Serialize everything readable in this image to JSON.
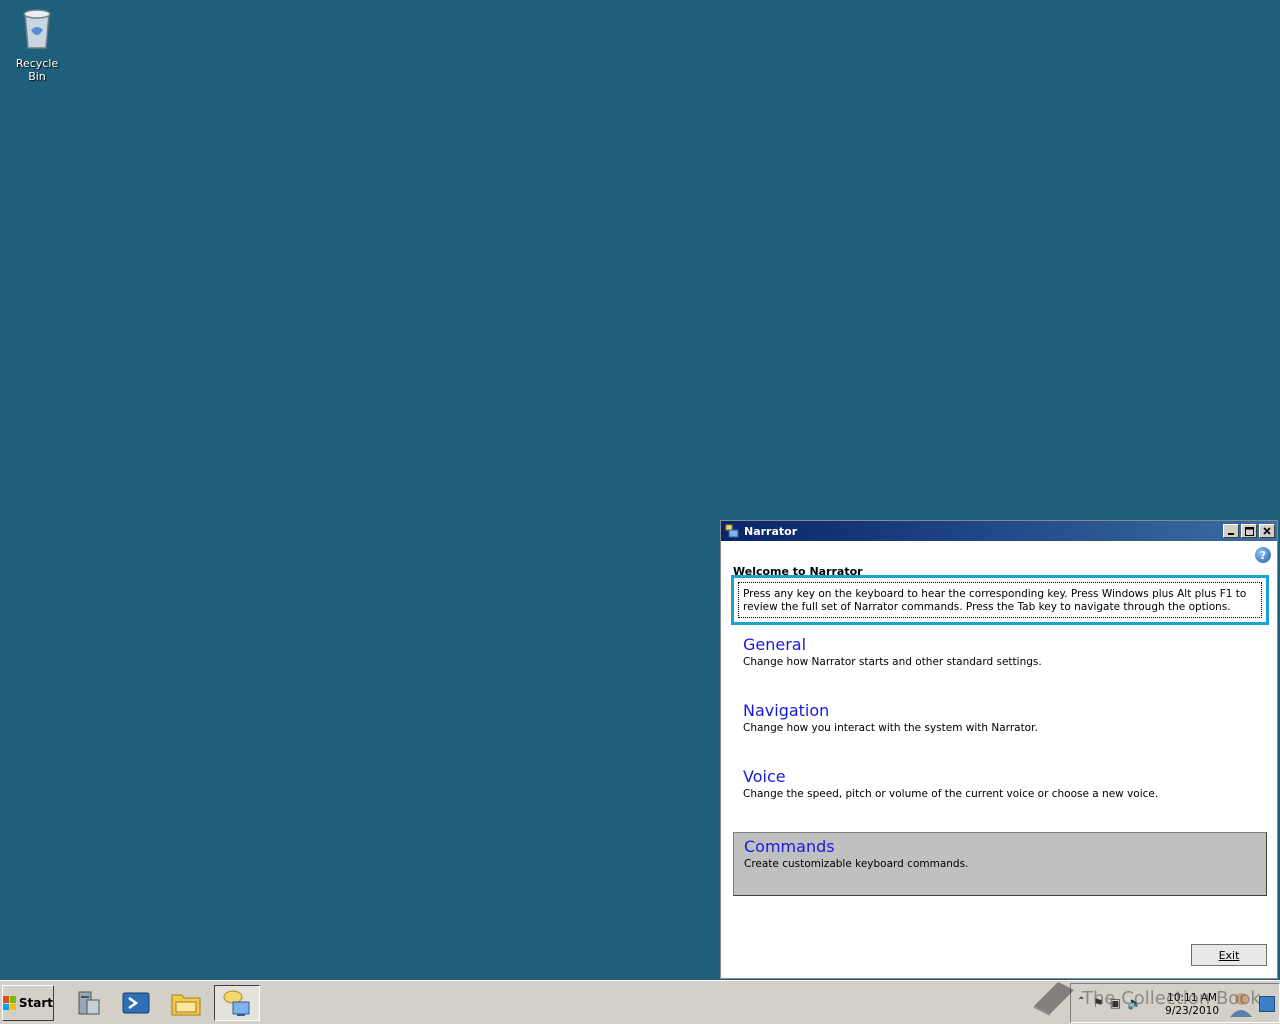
{
  "desktop": {
    "icons": [
      {
        "label": "Recycle Bin",
        "icon": "recycle-bin-icon"
      }
    ]
  },
  "window": {
    "title": "Narrator",
    "heading": "Welcome to Narrator",
    "intro": "Press any key on the keyboard to hear the corresponding key. Press Windows plus Alt plus F1 to review the full set of Narrator commands. Press the Tab key to navigate through the options.",
    "options": [
      {
        "title": "General",
        "description": "Change how Narrator starts and other standard settings."
      },
      {
        "title": "Navigation",
        "description": "Change how you interact with the system with Narrator."
      },
      {
        "title": "Voice",
        "description": "Change the speed, pitch or volume of the current voice or choose a new voice."
      },
      {
        "title": "Commands",
        "description": "Create customizable keyboard commands."
      }
    ],
    "selected_option": "Commands",
    "exit_label": "Exit",
    "help_glyph": "?"
  },
  "taskbar": {
    "start_label": "Start",
    "apps": [
      "server-manager-icon",
      "powershell-icon",
      "explorer-icon",
      "narrator-icon"
    ],
    "active_app": "narrator-icon",
    "clock": {
      "time": "10:11 AM",
      "date": "9/23/2010"
    }
  },
  "watermark": "The Collection Book"
}
